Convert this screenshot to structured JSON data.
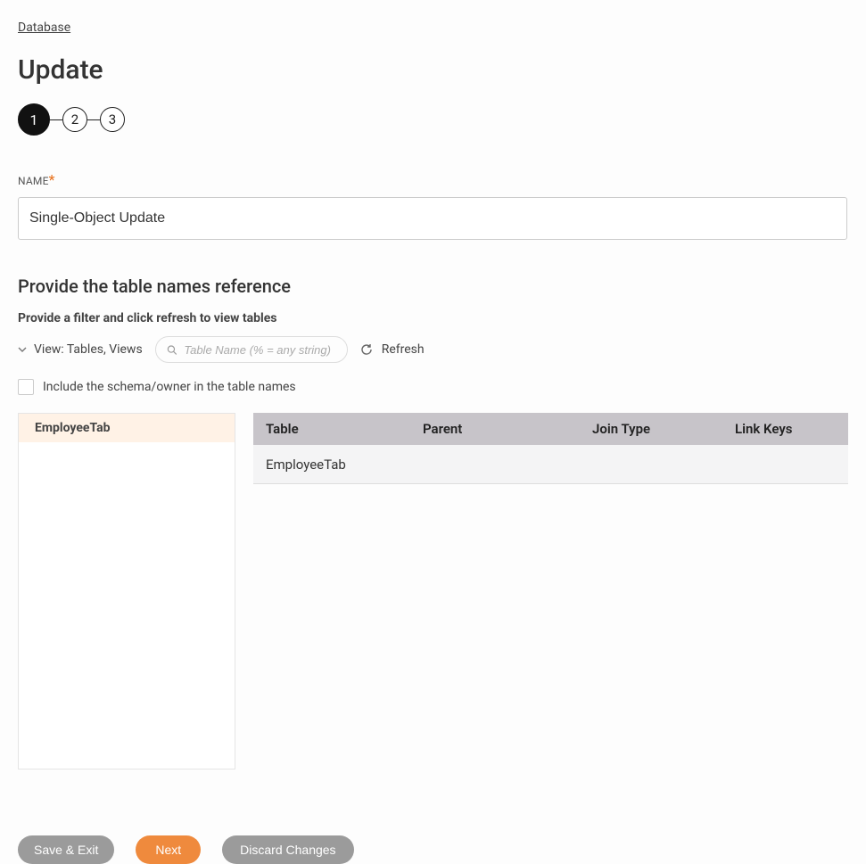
{
  "breadcrumb": {
    "label": "Database"
  },
  "page": {
    "title": "Update"
  },
  "stepper": {
    "steps": [
      "1",
      "2",
      "3"
    ],
    "active": 0
  },
  "name_field": {
    "label": "NAME",
    "value": "Single-Object Update"
  },
  "section": {
    "title": "Provide the table names reference",
    "sub": "Provide a filter and click refresh to view tables"
  },
  "filter": {
    "view_label": "View: Tables, Views",
    "search_placeholder": "Table Name (% = any string)",
    "refresh_label": "Refresh",
    "schema_checkbox_label": "Include the schema/owner in the table names"
  },
  "left_list": {
    "items": [
      "EmployeeTab"
    ],
    "selected_index": 0
  },
  "table": {
    "headers": {
      "table": "Table",
      "parent": "Parent",
      "join": "Join Type",
      "link": "Link Keys"
    },
    "rows": [
      {
        "table": "EmployeeTab",
        "parent": "",
        "join": "",
        "link": ""
      }
    ]
  },
  "buttons": {
    "save_exit": "Save & Exit",
    "next": "Next",
    "discard": "Discard Changes"
  }
}
